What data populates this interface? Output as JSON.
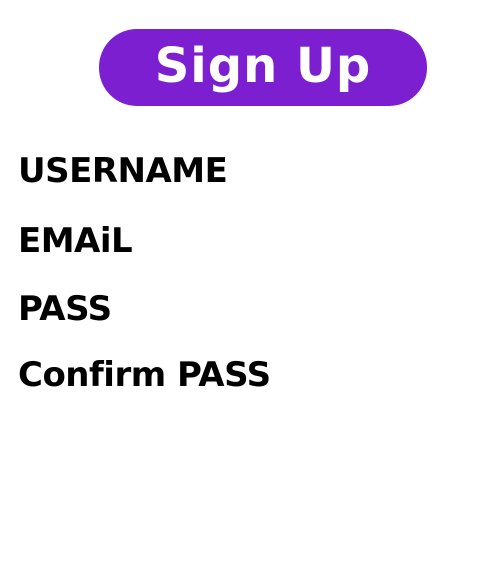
{
  "header": {
    "title": "Sign Up",
    "accent_color": "#7b1fd0"
  },
  "form": {
    "username_label": "USERNAME",
    "email_label": "EMAiL",
    "password_label": "PASS",
    "confirm_password_label": "Confirm PASS"
  }
}
